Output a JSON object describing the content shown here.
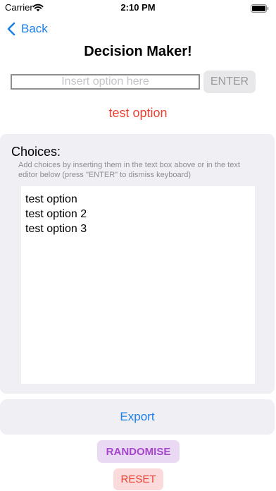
{
  "status_bar": {
    "carrier": "Carrier",
    "time": "2:10 PM"
  },
  "nav": {
    "back_label": "Back"
  },
  "title": "Decision Maker!",
  "option_input": {
    "placeholder": "Insert option here",
    "value": ""
  },
  "enter_button": "ENTER",
  "selected_option": "test option",
  "choices": {
    "heading": "Choices:",
    "hint": "Add choices by inserting them in the text box above or in the text editor below (press \"ENTER\" to dismiss keyboard)",
    "items": [
      "test option",
      "test option 2",
      "test option 3"
    ]
  },
  "export_button": "Export",
  "randomise_button": "RANDOMISE",
  "reset_button": "RESET",
  "colors": {
    "accent_blue": "#1a7fe8",
    "selected_red": "#ea4133",
    "randomise_purple": "#a547cf",
    "panel_gray": "#efeff4"
  },
  "icons": {
    "wifi": "wifi-icon",
    "battery": "battery-icon",
    "back": "chevron-left-icon"
  }
}
